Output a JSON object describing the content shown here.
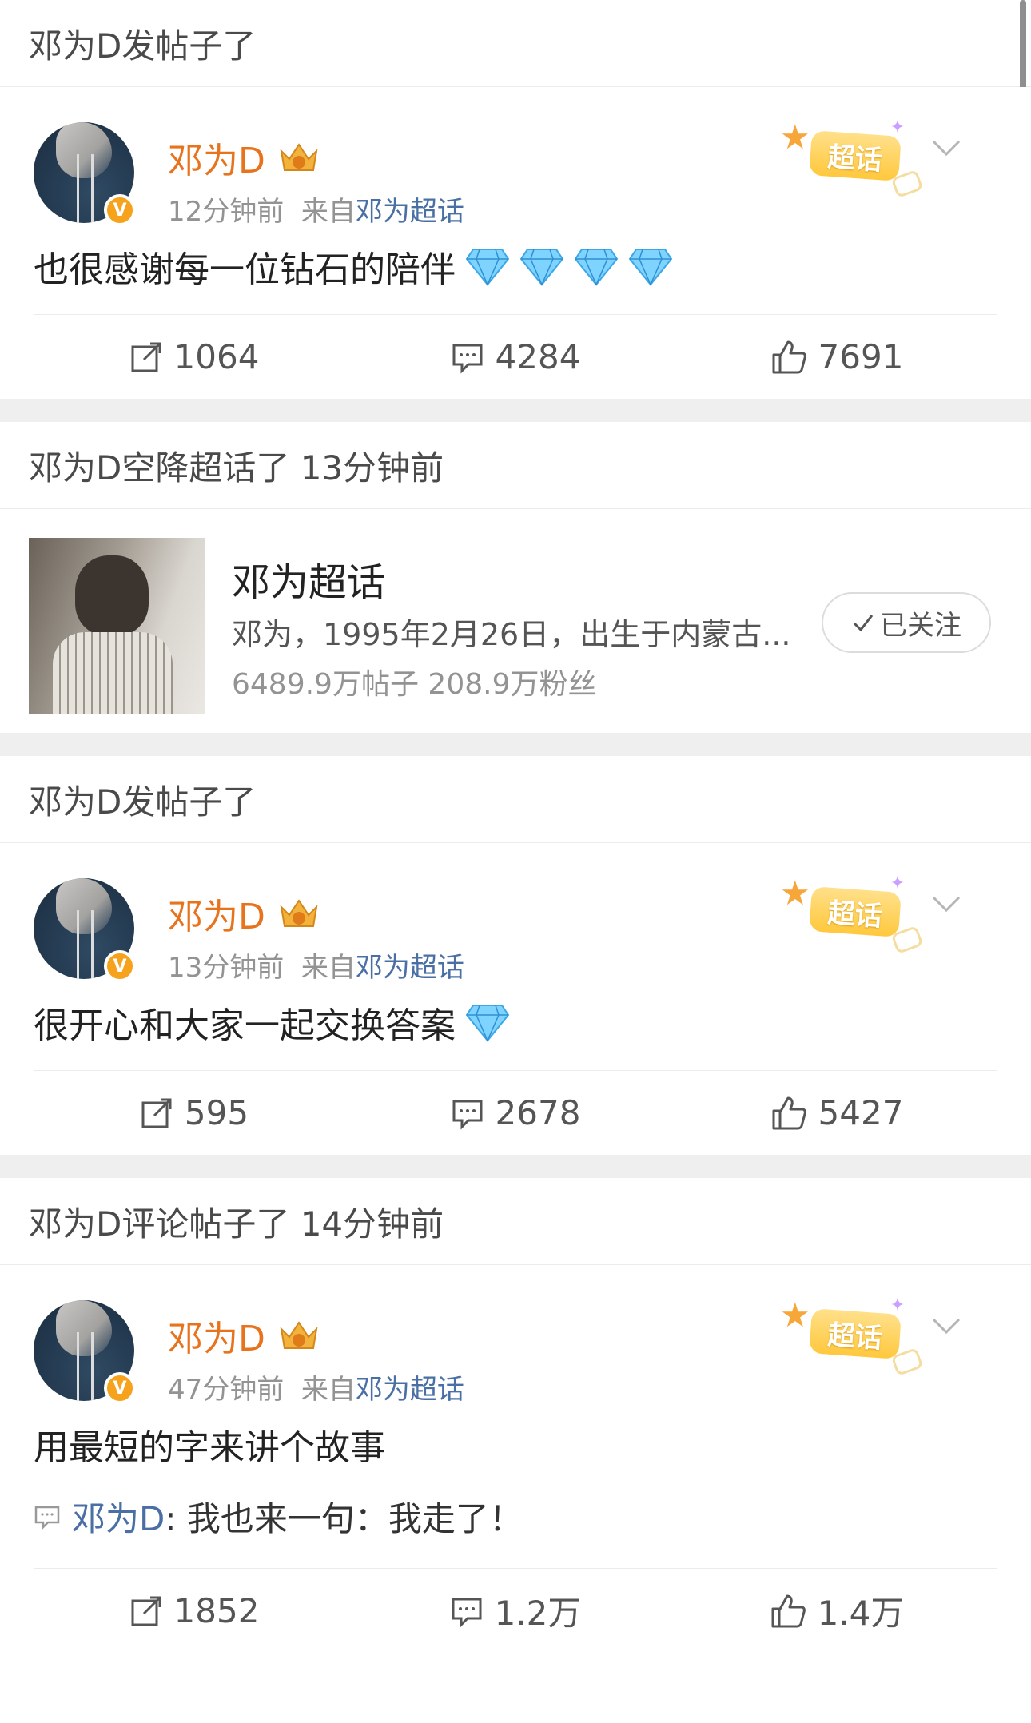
{
  "sections": [
    {
      "header": "邓为D发帖子了",
      "post": {
        "author": "邓为D",
        "time": "12分钟前",
        "source_prefix": "来自",
        "source_link": "邓为超话",
        "badge": "超话",
        "text": "也很感谢每一位钻石的陪伴",
        "diamonds": 4,
        "repost_count": "1064",
        "comment_count": "4284",
        "like_count": "7691"
      }
    },
    {
      "header": "邓为D空降超话了 13分钟前",
      "topic": {
        "title": "邓为超话",
        "description": "邓为，1995年2月26日，出生于内蒙古...",
        "stats": "6489.9万帖子  208.9万粉丝",
        "follow_label": "已关注"
      }
    },
    {
      "header": "邓为D发帖子了",
      "post": {
        "author": "邓为D",
        "time": "13分钟前",
        "source_prefix": "来自",
        "source_link": "邓为超话",
        "badge": "超话",
        "text": "很开心和大家一起交换答案",
        "diamonds": 1,
        "repost_count": "595",
        "comment_count": "2678",
        "like_count": "5427"
      }
    },
    {
      "header": "邓为D评论帖子了 14分钟前",
      "post": {
        "author": "邓为D",
        "time": "47分钟前",
        "source_prefix": "来自",
        "source_link": "邓为超话",
        "badge": "超话",
        "text": "用最短的字来讲个故事",
        "comment_author": "邓为D",
        "comment_text": ": 我也来一句：我走了！",
        "repost_count": "1852",
        "comment_count": "1.2万",
        "like_count": "1.4万"
      }
    }
  ],
  "colors": {
    "accent_orange": "#e8731d",
    "link_blue": "#4a6fa5",
    "verified_badge": "#f6a21d",
    "divider_gap": "#efefef"
  }
}
